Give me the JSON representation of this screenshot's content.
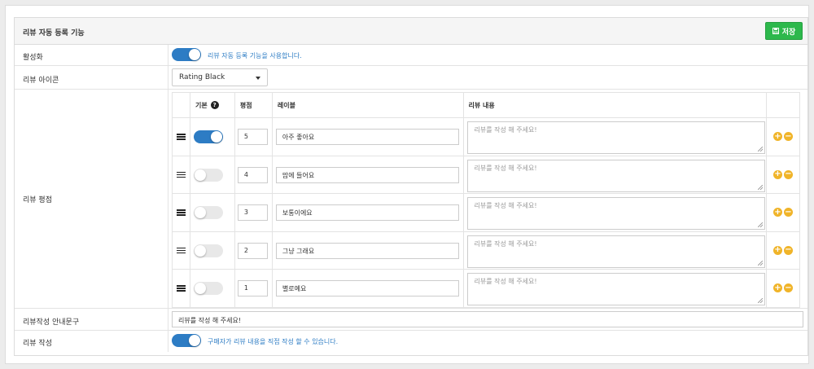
{
  "panel": {
    "title": "리뷰 자동 등록 기능",
    "save_label": "저장",
    "save_icon": "floppy-disk-icon",
    "accent_green": "#2db84c",
    "accent_blue": "#2d7cc4",
    "action_yellow": "#f0b429"
  },
  "activation": {
    "label": "활성화",
    "enabled": true,
    "help": "리뷰 자동 등록 기능을 사용합니다."
  },
  "icon_setting": {
    "label": "리뷰 아이콘",
    "selected": "Rating Black"
  },
  "rating": {
    "label": "리뷰 평점",
    "headers": {
      "default": "기본",
      "score": "평점",
      "label": "레이블",
      "content": "리뷰 내용"
    },
    "rows": [
      {
        "default": true,
        "score": "5",
        "label": "아주 좋아요",
        "placeholder": "리뷰를 작성 해 주세요!"
      },
      {
        "default": false,
        "score": "4",
        "label": "맘에 들어요",
        "placeholder": "리뷰를 작성 해 주세요!"
      },
      {
        "default": false,
        "score": "3",
        "label": "보통이에요",
        "placeholder": "리뷰를 작성 해 주세요!"
      },
      {
        "default": false,
        "score": "2",
        "label": "그냥 그래요",
        "placeholder": "리뷰를 작성 해 주세요!"
      },
      {
        "default": false,
        "score": "1",
        "label": "별로예요",
        "placeholder": "리뷰를 작성 해 주세요!"
      }
    ]
  },
  "guide": {
    "label": "리뷰작성 안내문구",
    "value": "리뷰를 작성 해 주세요!"
  },
  "write": {
    "label": "리뷰 작성",
    "enabled": true,
    "help": "구매자가 리뷰 내용을 직접 작성 할 수 있습니다."
  }
}
